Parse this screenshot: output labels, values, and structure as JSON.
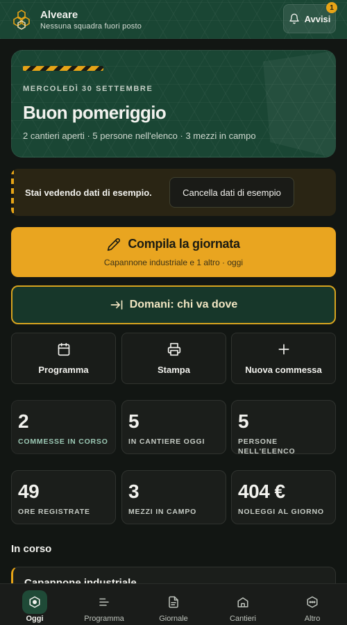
{
  "header": {
    "title": "Alveare",
    "subtitle": "Nessuna squadra fuori posto",
    "notifications_label": "Avvisi",
    "notifications_count": "1",
    "logo_icon": "honeycomb-icon"
  },
  "hero": {
    "date": "MERCOLEDÌ 30 SETTEMBRE",
    "greeting": "Buon pomeriggio",
    "summary": "2 cantieri aperti · 5 persone nell'elenco · 3 mezzi in campo"
  },
  "sample_banner": {
    "text": "Stai vedendo dati di esempio.",
    "clear_label": "Cancella dati di esempio"
  },
  "primary_action": {
    "title": "Compila la giornata",
    "subtitle": "Capannone industriale e 1 altro · oggi",
    "icon": "pencil-icon"
  },
  "secondary_action": {
    "title": "Domani: chi va dove",
    "icon": "arrow-right-to-line-icon"
  },
  "quick_actions": [
    {
      "label": "Programma",
      "icon": "calendar-icon"
    },
    {
      "label": "Stampa",
      "icon": "printer-icon"
    },
    {
      "label": "Nuova commessa",
      "icon": "plus-icon"
    }
  ],
  "stats": [
    {
      "value": "2",
      "label": "Commesse in corso"
    },
    {
      "value": "5",
      "label": "In cantiere oggi"
    },
    {
      "value": "5",
      "label": "Persone nell'elenco"
    },
    {
      "value": "49",
      "label": "Ore registrate"
    },
    {
      "value": "3",
      "label": "Mezzi in campo"
    },
    {
      "value": "404 €",
      "label": "Noleggi al giorno"
    }
  ],
  "in_progress": {
    "title": "In corso",
    "items": [
      {
        "name": "Capannone industriale"
      }
    ]
  },
  "bottom_nav": [
    {
      "label": "Oggi",
      "icon": "hexagon-home-icon",
      "active": true
    },
    {
      "label": "Programma",
      "icon": "lines-icon"
    },
    {
      "label": "Giornale",
      "icon": "document-icon"
    },
    {
      "label": "Cantieri",
      "icon": "site-icon"
    },
    {
      "label": "Altro",
      "icon": "more-icon"
    }
  ],
  "colors": {
    "accent": "#e9a520",
    "green": "#1a4634",
    "background": "#121613"
  }
}
